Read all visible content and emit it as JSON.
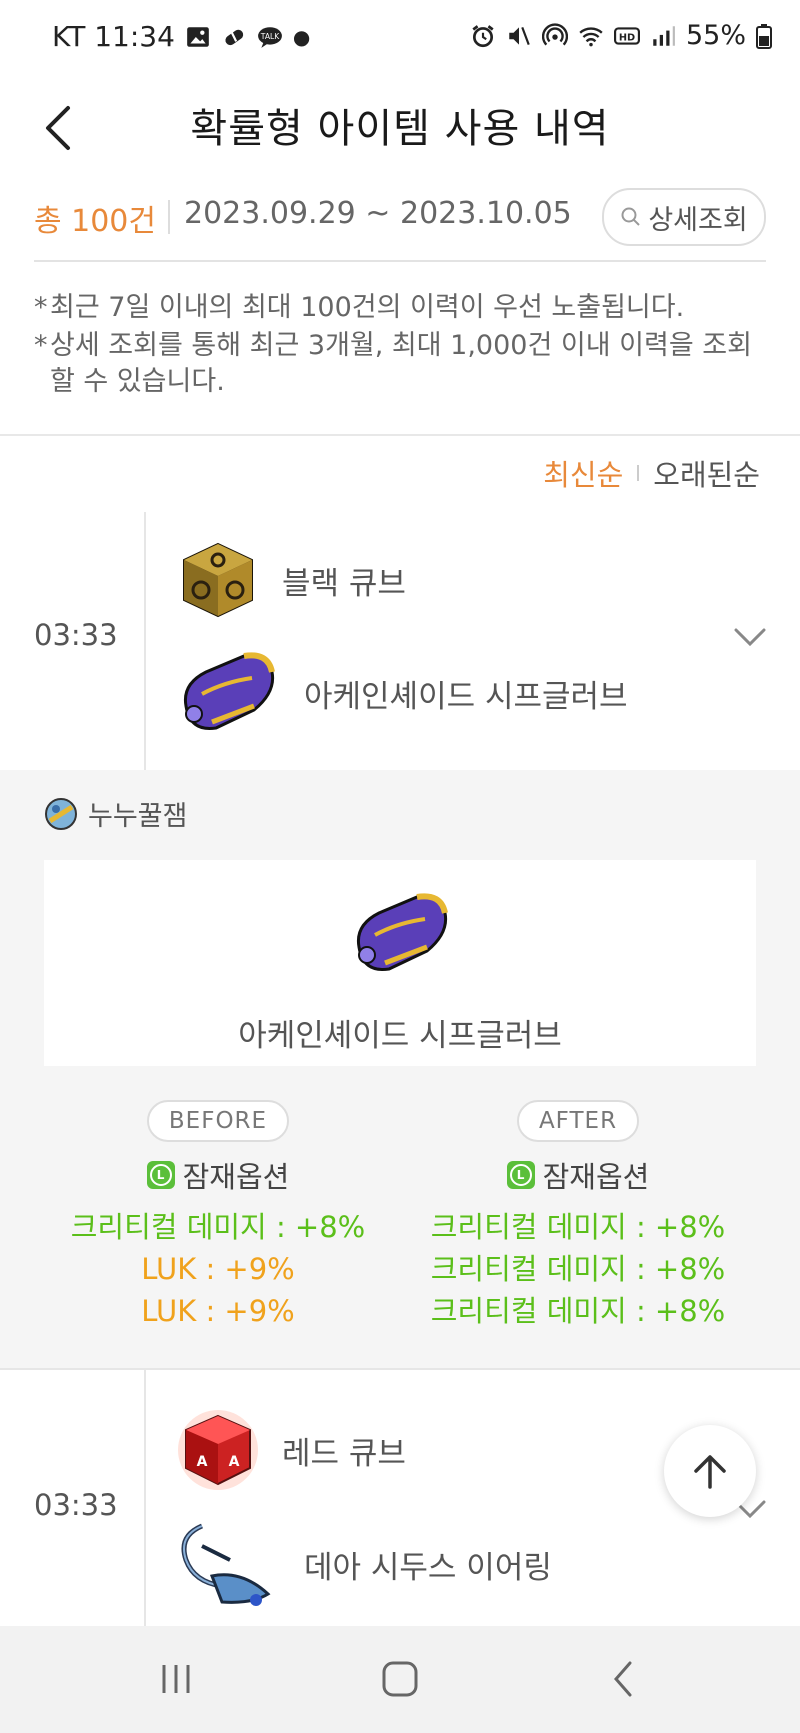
{
  "status_bar": {
    "carrier_time": "KT 11:34",
    "battery": "55%"
  },
  "header": {
    "title": "확률형 아이템 사용 내역"
  },
  "summary": {
    "total": "총 100건",
    "date_range": "2023.09.29 ~ 2023.10.05",
    "detail_search_label": "상세조회"
  },
  "notes": [
    "최근 7일 이내의 최대 100건의 이력이 우선 노출됩니다.",
    "상세 조회를 통해 최근 3개월, 최대 1,000건 이내 이력을 조회 할 수 있습니다."
  ],
  "sort": {
    "newest": "최신순",
    "oldest": "오래된순"
  },
  "entries": [
    {
      "time": "03:33",
      "cube_name": "블랙 큐브",
      "item_name": "아케인셰이드 시프글러브"
    },
    {
      "time": "03:33",
      "cube_name": "레드 큐브",
      "item_name": "데아 시두스 이어링"
    }
  ],
  "detail": {
    "character": "누누꿀잼",
    "item_name": "아케인셰이드 시프글러브",
    "before": {
      "label": "BEFORE",
      "potential_title": "잠재옵션",
      "options": [
        "크리티컬 데미지 : +8%",
        "LUK : +9%",
        "LUK : +9%"
      ]
    },
    "after": {
      "label": "AFTER",
      "potential_title": "잠재옵션",
      "options": [
        "크리티컬 데미지 : +8%",
        "크리티컬 데미지 : +8%",
        "크리티컬 데미지 : +8%"
      ]
    }
  },
  "colors": {
    "accent": "#e8893a",
    "legendary_green": "#5bbf1a",
    "unique_yellow": "#f0a21c"
  }
}
